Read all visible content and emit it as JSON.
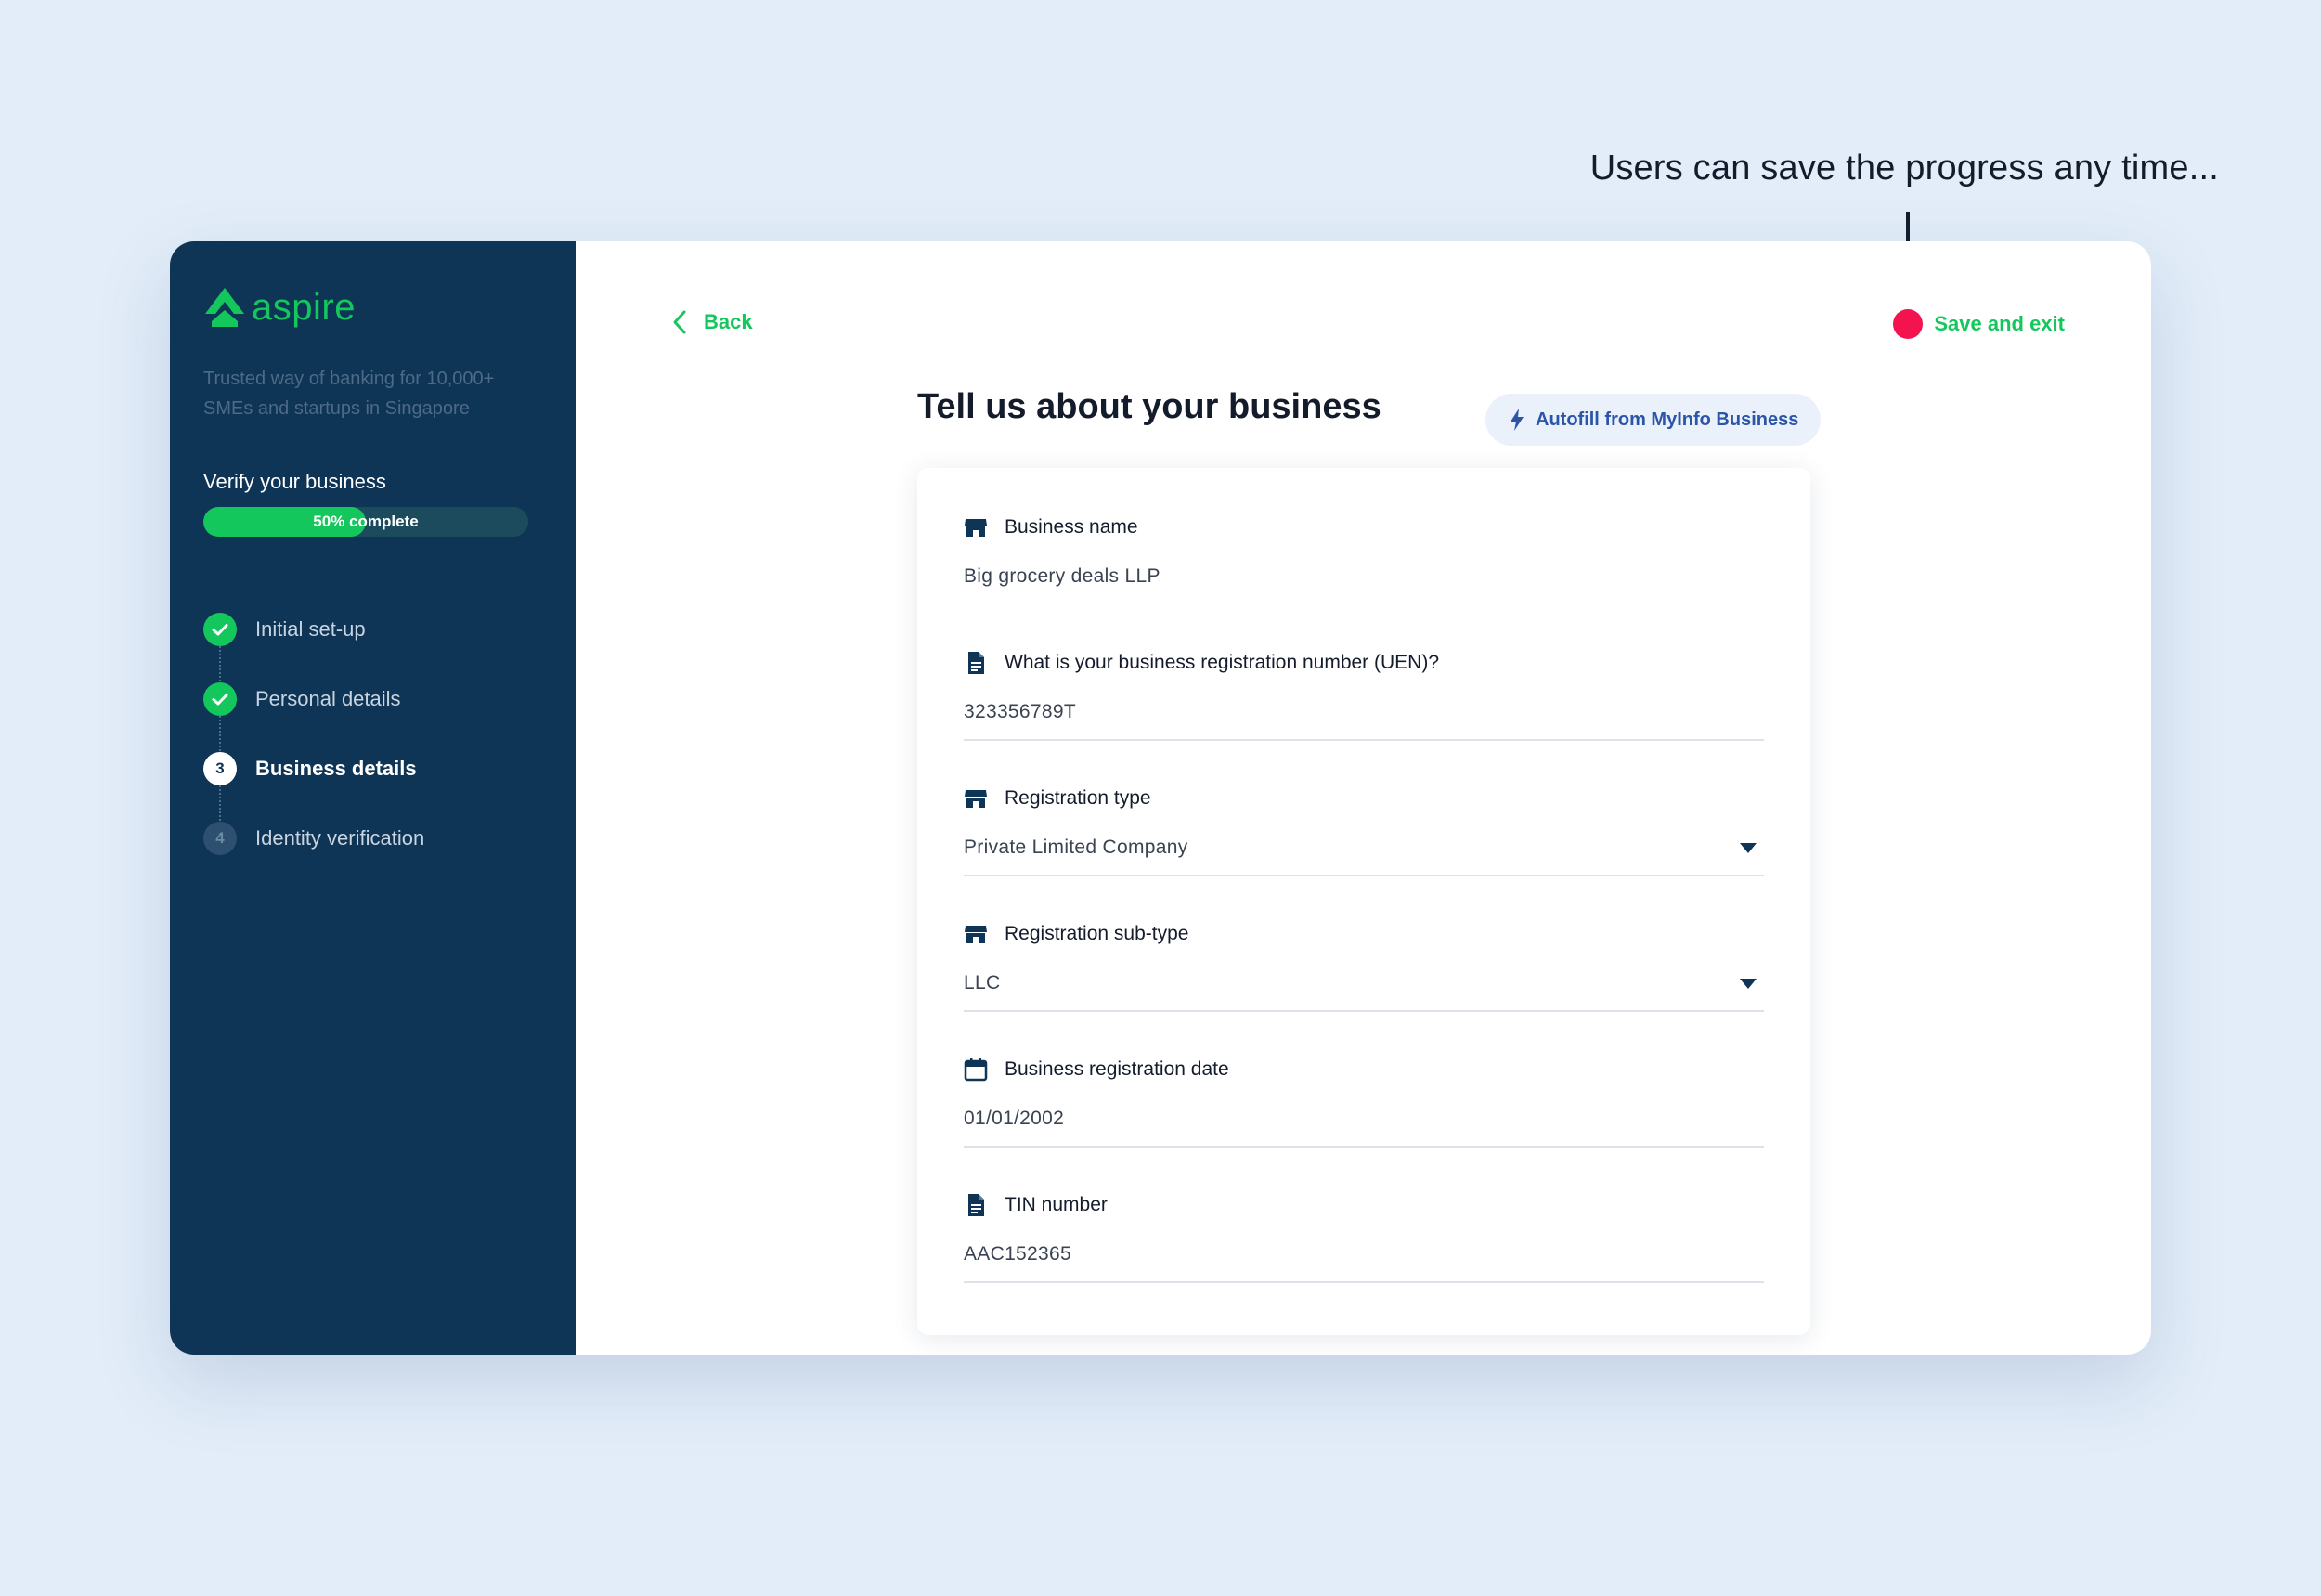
{
  "annotation": {
    "text": "Users can save the progress any time..."
  },
  "sidebar": {
    "brand": "aspire",
    "tagline": "Trusted way of banking for 10,000+ SMEs and startups in Singapore",
    "verify_title": "Verify your business",
    "progress": {
      "percent": 50,
      "label": "50% complete"
    },
    "steps": [
      {
        "label": "Initial set-up",
        "status": "done",
        "number": "1"
      },
      {
        "label": "Personal details",
        "status": "done",
        "number": "2"
      },
      {
        "label": "Business details",
        "status": "current",
        "number": "3"
      },
      {
        "label": "Identity verification",
        "status": "pending",
        "number": "4"
      }
    ]
  },
  "header": {
    "back_label": "Back",
    "save_exit_label": "Save and exit"
  },
  "main": {
    "title": "Tell us about your business",
    "autofill_label": "Autofill from MyInfo Business"
  },
  "form": {
    "fields": [
      {
        "label": "Business name",
        "value": "Big grocery deals LLP",
        "icon": "store-icon",
        "type": "text",
        "underline": false
      },
      {
        "label": "What is your business registration number (UEN)?",
        "value": "323356789T",
        "icon": "document-icon",
        "type": "text",
        "underline": true
      },
      {
        "label": "Registration type",
        "value": "Private Limited Company",
        "icon": "store-icon",
        "type": "select",
        "underline": true
      },
      {
        "label": "Registration sub-type",
        "value": "LLC",
        "icon": "store-icon",
        "type": "select",
        "underline": true
      },
      {
        "label": "Business registration date",
        "value": "01/01/2002",
        "icon": "calendar-icon",
        "type": "text",
        "underline": true
      },
      {
        "label": "TIN number",
        "value": "AAC152365",
        "icon": "document-icon",
        "type": "text",
        "underline": true
      }
    ]
  },
  "colors": {
    "brand_green": "#14c75d",
    "sidebar_navy": "#0e3456",
    "annotation_dot": "#f3134f",
    "autofill_blue": "#2c55a8"
  }
}
